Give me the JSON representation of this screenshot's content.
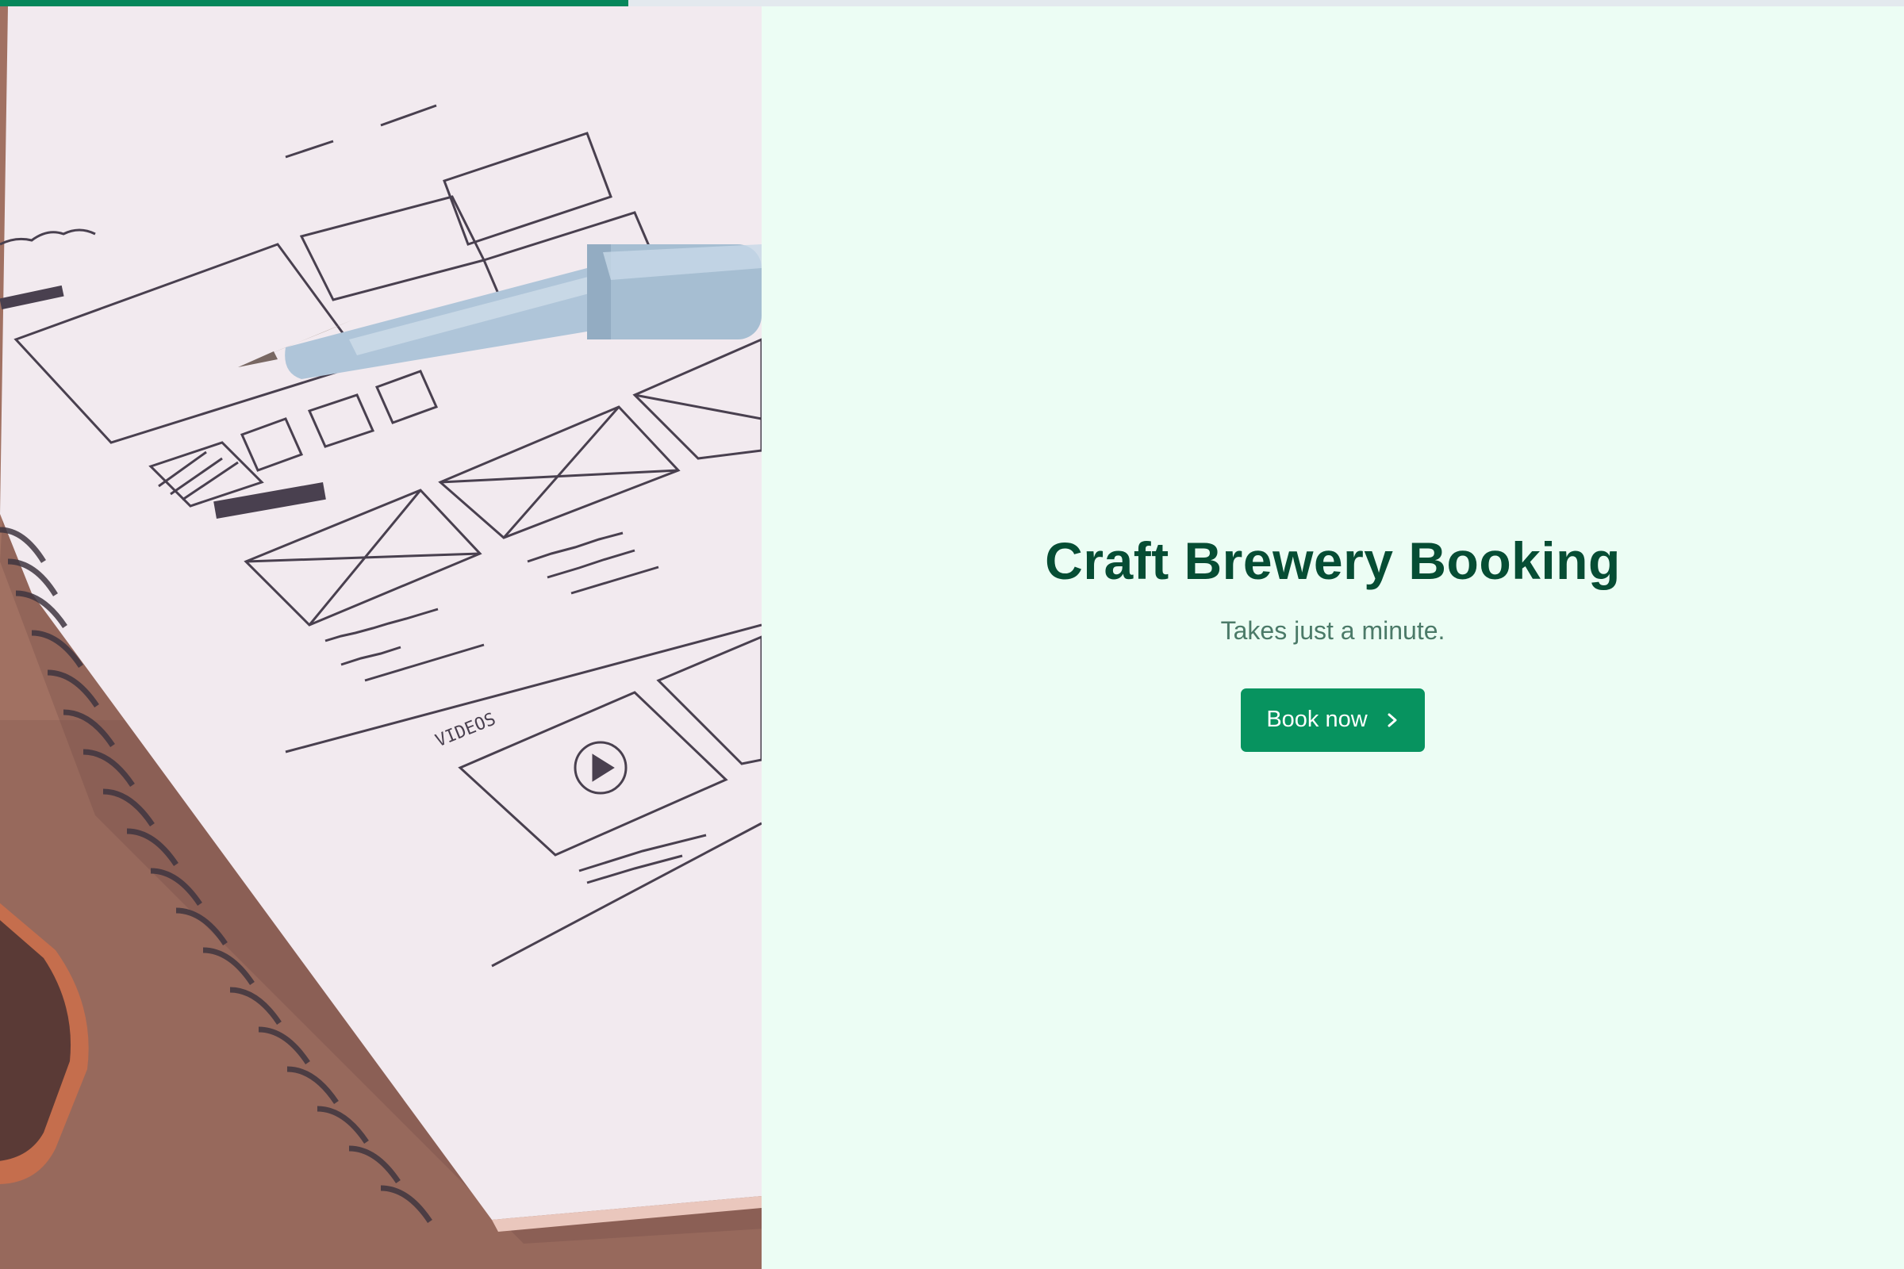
{
  "progress": {
    "fraction": 0.33
  },
  "hero": {
    "image": "notebook-wireframe-sketch-photo",
    "sketch_label": "VIDEOS"
  },
  "main": {
    "title": "Craft Brewery Booking",
    "subtitle": "Takes just a minute.",
    "cta_label": "Book now",
    "cta_icon": "chevron-right-icon"
  },
  "colors": {
    "accent": "#07935f",
    "progress": "#07875b",
    "background": "#ecfdf4",
    "title": "#064d34",
    "subtitle": "#4b7a68"
  }
}
